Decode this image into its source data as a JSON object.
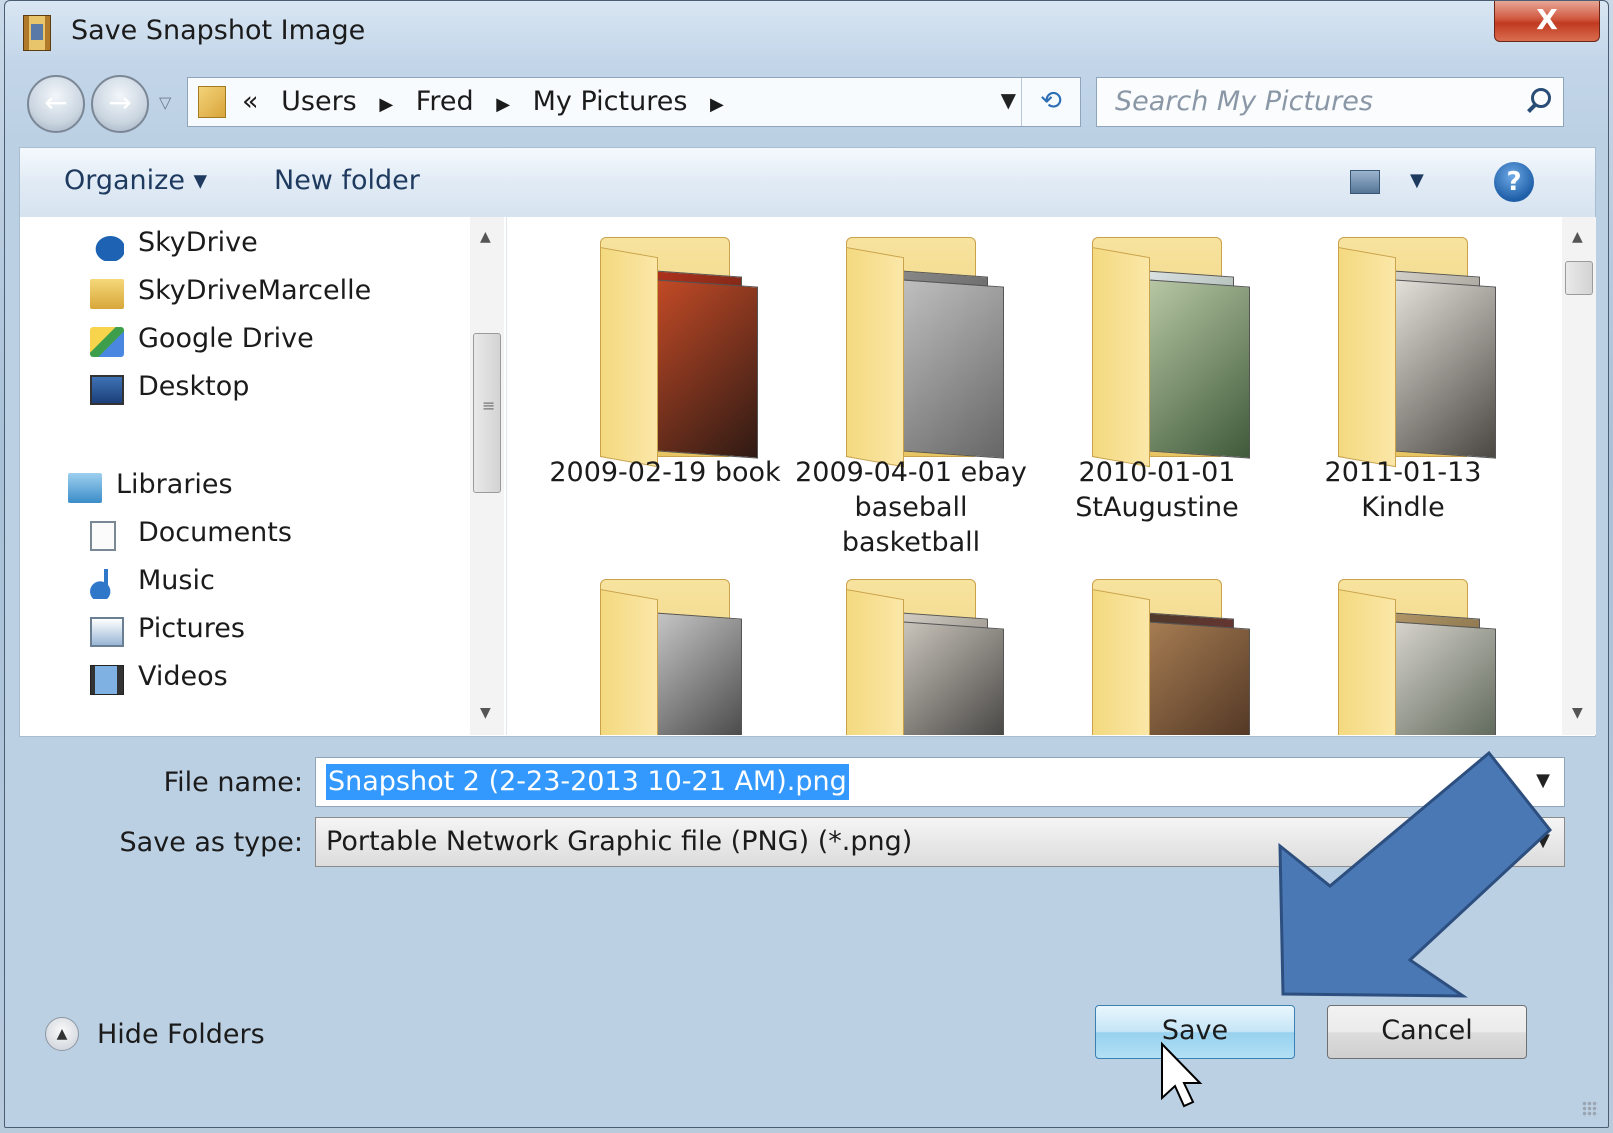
{
  "window": {
    "title": "Save Snapshot Image",
    "close_glyph": "X"
  },
  "nav": {
    "back_glyph": "←",
    "forward_glyph": "→",
    "history_dropdown_glyph": "▽",
    "breadcrumb_overflow": "«",
    "breadcrumbs": [
      "Users",
      "Fred",
      "My Pictures"
    ],
    "separator": "▶",
    "address_dropdown_glyph": "▼",
    "refresh_glyph": "⟲",
    "search_placeholder": "Search My Pictures"
  },
  "toolbar": {
    "organize_label": "Organize ▾",
    "new_folder_label": "New folder",
    "view_dropdown_glyph": "▼",
    "help_glyph": "?"
  },
  "sidebar": {
    "items": [
      {
        "label": "SkyDrive",
        "icon": "skydrive-icon"
      },
      {
        "label": "SkyDriveMarcelle",
        "icon": "folder-icon"
      },
      {
        "label": "Google Drive",
        "icon": "google-drive-icon"
      },
      {
        "label": "Desktop",
        "icon": "desktop-icon"
      },
      {
        "label": "Libraries",
        "icon": "libraries-icon"
      },
      {
        "label": "Documents",
        "icon": "documents-icon"
      },
      {
        "label": "Music",
        "icon": "music-icon"
      },
      {
        "label": "Pictures",
        "icon": "pictures-icon"
      },
      {
        "label": "Videos",
        "icon": "videos-icon"
      }
    ],
    "scroll_up_glyph": "▲",
    "scroll_down_glyph": "▼",
    "grip_glyph": "≡"
  },
  "folders": {
    "items": [
      {
        "label": "2009-02-19 book"
      },
      {
        "label": "2009-04-01 ebay baseball basketball"
      },
      {
        "label": "2010-01-01 StAugustine"
      },
      {
        "label": "2011-01-13 Kindle"
      },
      {
        "label": ""
      },
      {
        "label": ""
      },
      {
        "label": ""
      },
      {
        "label": ""
      }
    ],
    "scroll_up_glyph": "▲",
    "scroll_down_glyph": "▼"
  },
  "form": {
    "file_name_label": "File name:",
    "file_name_value": "Snapshot 2 (2-23-2013 10-21 AM).png",
    "save_type_label": "Save as type:",
    "save_type_value": "Portable Network Graphic file (PNG) (*.png)",
    "dropdown_glyph": "▼"
  },
  "footer": {
    "hide_folders_label": "Hide Folders",
    "hide_folders_glyph": "▲",
    "save_label": "Save",
    "cancel_label": "Cancel"
  },
  "colors": {
    "selection": "#3399ff",
    "annotation_arrow": "#4a78b5",
    "close_button": "#c9472b"
  }
}
